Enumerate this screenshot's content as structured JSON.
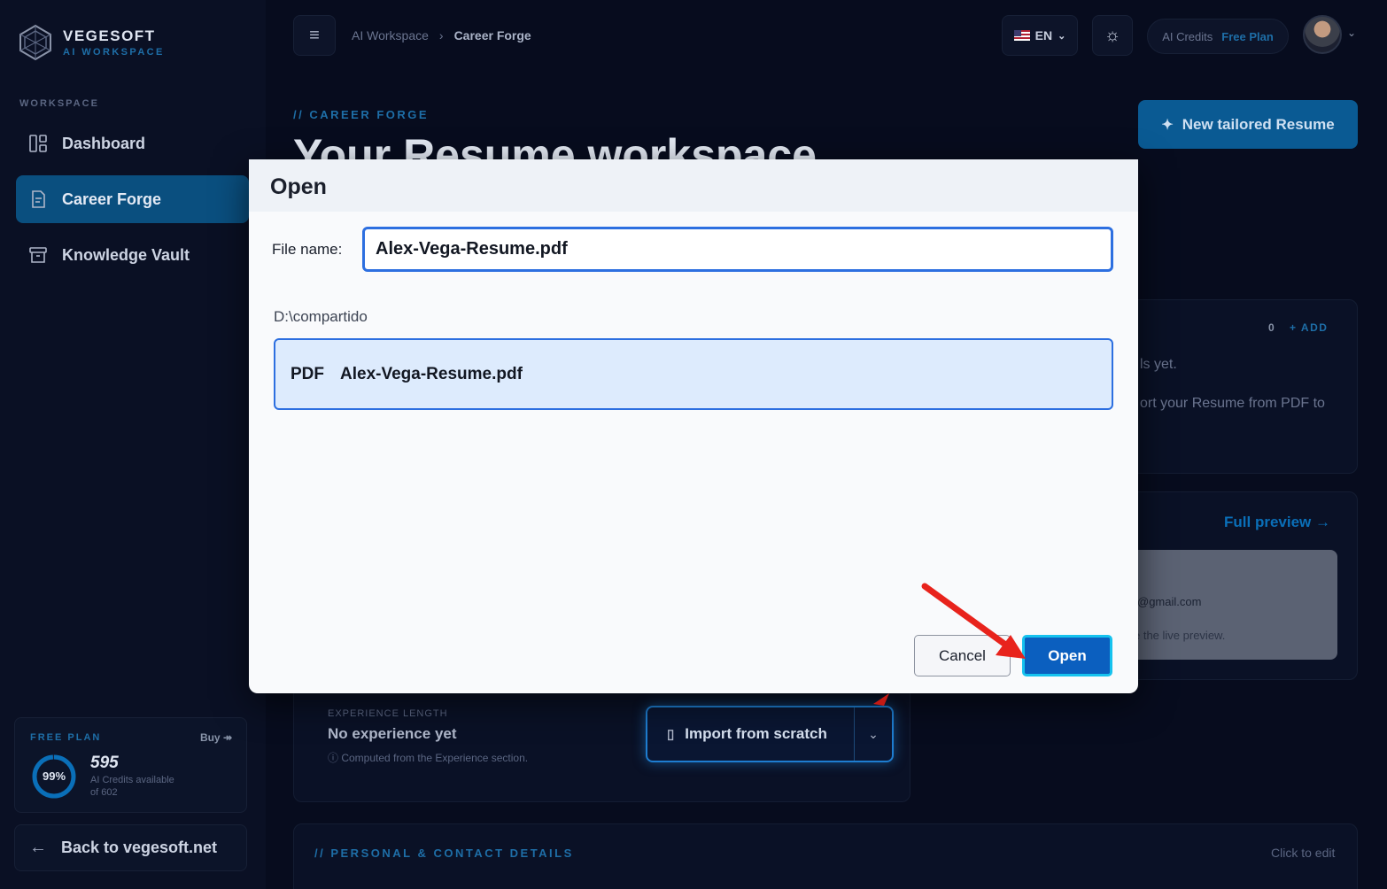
{
  "brand": {
    "name": "VEGESOFT",
    "sub": "AI WORKSPACE"
  },
  "sidebar": {
    "section_label": "WORKSPACE",
    "items": [
      {
        "label": "Dashboard",
        "icon": "dashboard-icon"
      },
      {
        "label": "Career Forge",
        "icon": "document-icon",
        "active": true
      },
      {
        "label": "Knowledge Vault",
        "icon": "archive-icon"
      }
    ],
    "plan": {
      "label": "FREE PLAN",
      "buy": "Buy ↠",
      "percent": "99%",
      "percent_value": 0.99,
      "credits": "595",
      "available": "AI Credits available",
      "of_total": "of 602"
    },
    "back_label": "Back to vegesoft.net"
  },
  "topbar": {
    "breadcrumb": [
      "AI Workspace",
      "Career Forge"
    ],
    "lang": "EN",
    "credits_label": "AI Credits",
    "plan_label": "Free Plan"
  },
  "main": {
    "eyebrow": "// CAREER FORGE",
    "title": "Your Resume workspace",
    "new_resume_label": "New tailored Resume",
    "skills": {
      "count": "0",
      "add": "+ ADD",
      "empty": "ls yet.",
      "import_hint": "ort your Resume from PDF to"
    },
    "preview": {
      "link": "Full preview →",
      "email": "@gmail.com",
      "hint": "e the live preview."
    },
    "experience": {
      "label": "EXPERIENCE LENGTH",
      "value": "No experience yet",
      "hint": "Computed from the Experience section."
    },
    "import_label": "Import from scratch",
    "personal_label": "// PERSONAL & CONTACT DETAILS",
    "click_edit": "Click to edit"
  },
  "dialog": {
    "title": "Open",
    "file_name_label": "File name:",
    "file_name_value": "Alex-Vega-Resume.pdf",
    "path": "D:\\compartido",
    "files": [
      {
        "type": "PDF",
        "name": "Alex-Vega-Resume.pdf"
      }
    ],
    "cancel_label": "Cancel",
    "open_label": "Open"
  },
  "colors": {
    "accent": "#1e6ea7",
    "open_button": "#0b5fbf",
    "focus_ring": "#16c2ee",
    "arrow": "#e8231c"
  }
}
